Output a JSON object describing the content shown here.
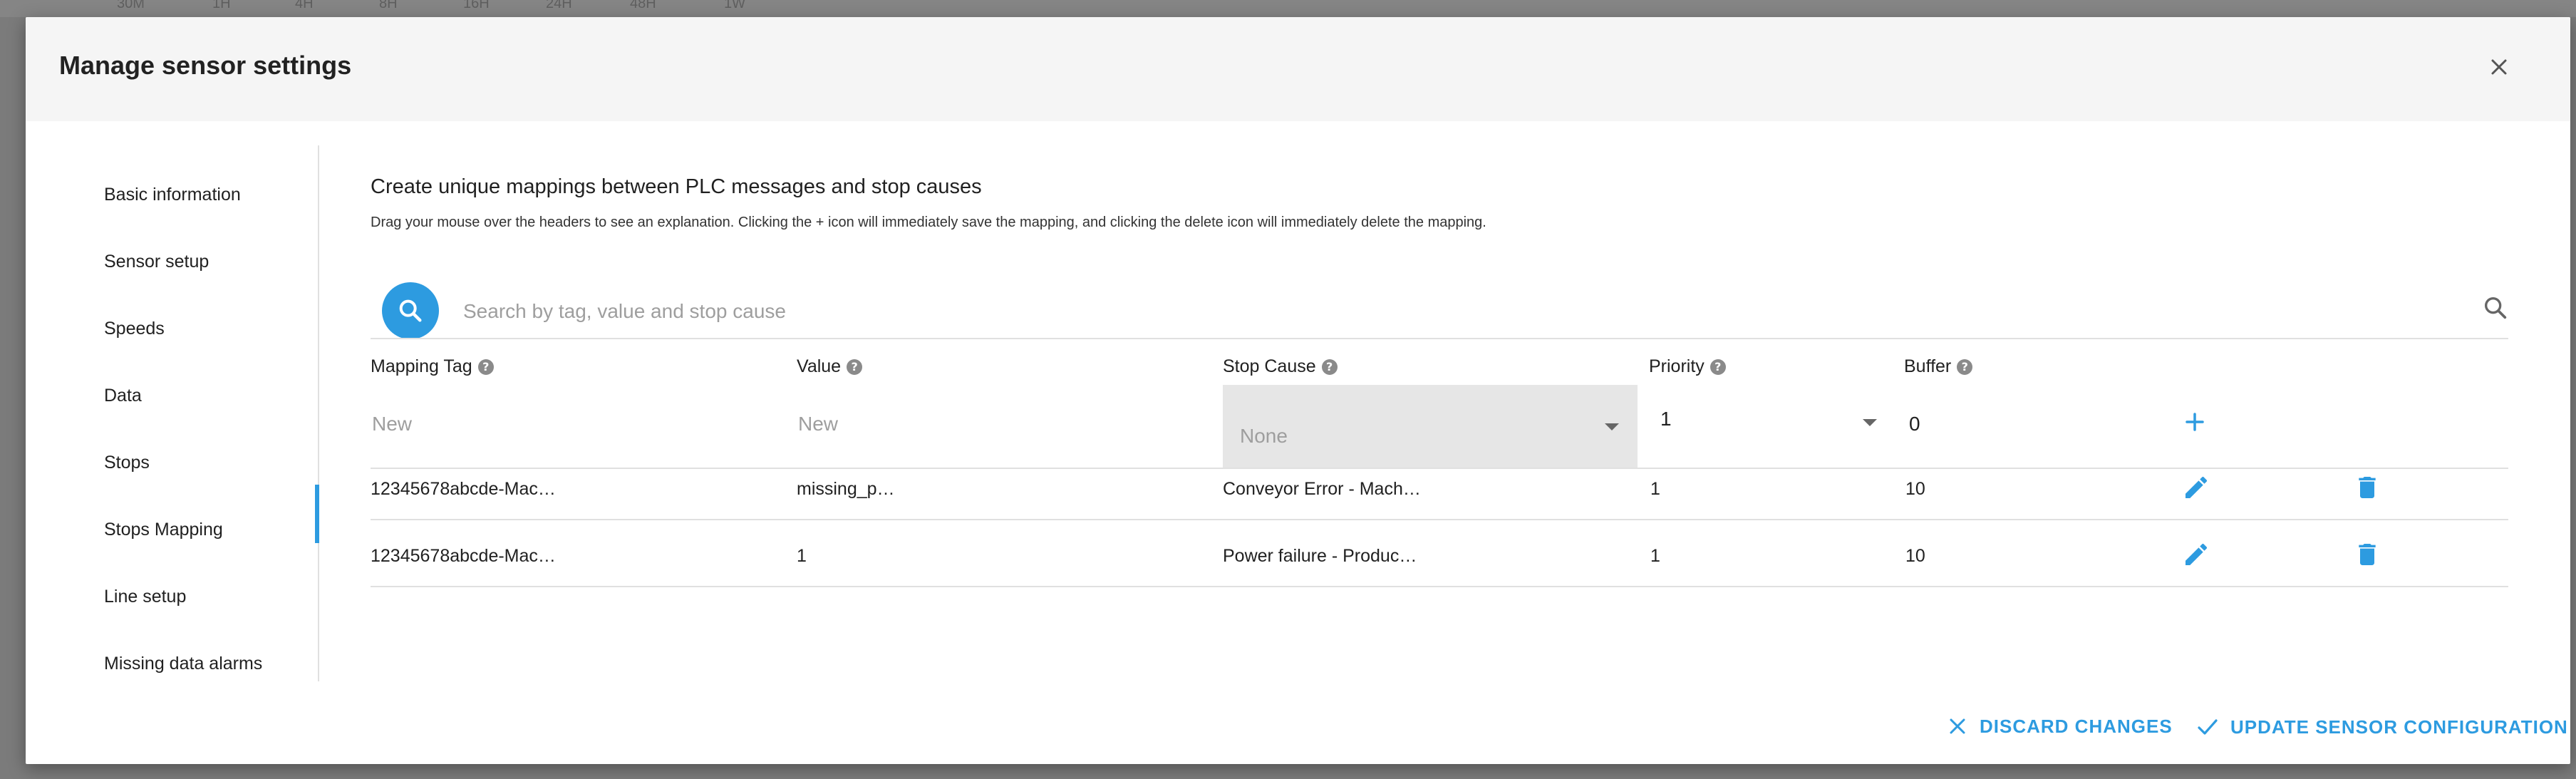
{
  "background": {
    "ticks": [
      "30M",
      "1H",
      "4H",
      "8H",
      "16H",
      "24H",
      "48H",
      "1W"
    ]
  },
  "dialog": {
    "title": "Manage sensor settings"
  },
  "sidebar": {
    "items": [
      {
        "label": "Basic information"
      },
      {
        "label": "Sensor setup"
      },
      {
        "label": "Speeds"
      },
      {
        "label": "Data"
      },
      {
        "label": "Stops"
      },
      {
        "label": "Stops Mapping",
        "active": true
      },
      {
        "label": "Line setup"
      },
      {
        "label": "Missing data alarms"
      }
    ]
  },
  "main": {
    "title": "Create unique mappings between PLC messages and stop causes",
    "description": "Drag your mouse over the headers to see an explanation. Clicking the + icon will immediately save the mapping, and clicking the delete icon will immediately delete the mapping.",
    "search": {
      "placeholder": "Search by tag, value and stop cause",
      "value": ""
    },
    "columns": {
      "mapping_tag": "Mapping Tag",
      "value": "Value",
      "stop_cause": "Stop Cause",
      "priority": "Priority",
      "buffer": "Buffer"
    },
    "new_row": {
      "mapping_tag_placeholder": "New",
      "value_placeholder": "New",
      "stop_cause": "None",
      "priority": "1",
      "buffer": "0"
    },
    "rows": [
      {
        "mapping_tag": "12345678abcde-Mac…",
        "value": "missing_p…",
        "stop_cause": "Conveyor Error - Mach…",
        "priority": "1",
        "buffer": "10"
      },
      {
        "mapping_tag": "12345678abcde-Mac…",
        "value": "1",
        "stop_cause": "Power failure - Produc…",
        "priority": "1",
        "buffer": "10"
      }
    ]
  },
  "footer": {
    "discard_label": "DISCARD CHANGES",
    "update_label": "UPDATE SENSOR CONFIGURATION"
  },
  "colors": {
    "accent": "#2d9be0",
    "header_bg": "#f5f5f5",
    "select_bg": "#e6e6e6"
  }
}
